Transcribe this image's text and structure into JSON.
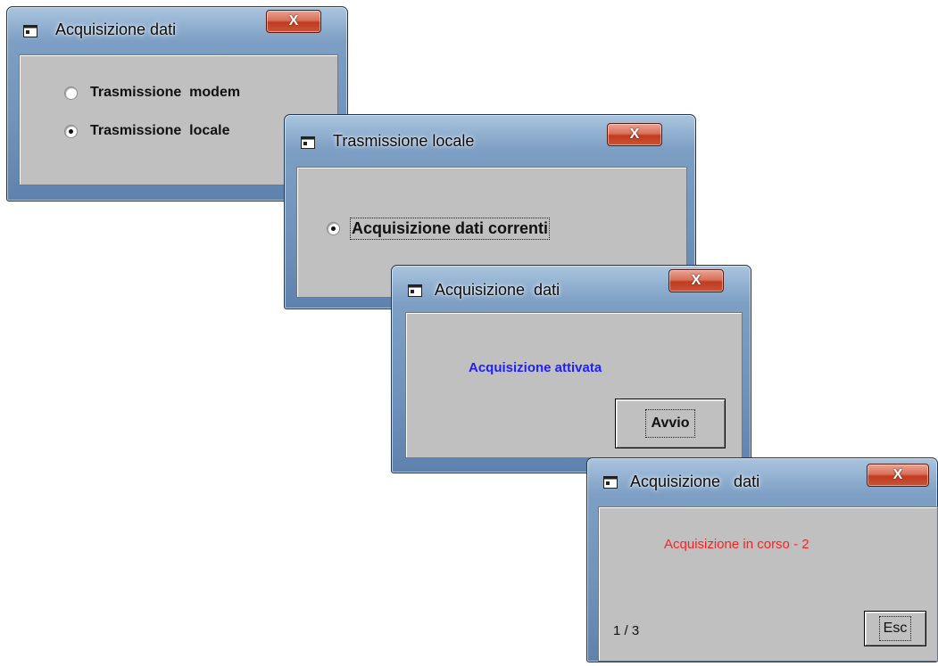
{
  "windows": {
    "acquisizione1": {
      "title": "Acquisizione dati",
      "close_label": "X",
      "options": [
        {
          "label": "Trasmissione  modem",
          "checked": false
        },
        {
          "label": "Trasmissione  locale",
          "checked": true
        }
      ]
    },
    "locale": {
      "title": "Trasmissione locale",
      "close_label": "X",
      "option": {
        "label": "Acquisizione dati correnti",
        "checked": true
      }
    },
    "acquisizione2": {
      "title": "Acquisizione  dati",
      "close_label": "X",
      "status": "Acquisizione attivata",
      "status_color": "#2020ff",
      "start_button": "Avvio"
    },
    "acquisizione3": {
      "title": "Acquisizione   dati",
      "close_label": "X",
      "progress_text": "Acquisizione in corso - 2",
      "progress_color": "#ff2020",
      "counter": "1 / 3",
      "esc_button": "Esc"
    }
  },
  "icons": {
    "window_icon": "window-icon",
    "close_icon": "close-icon"
  }
}
